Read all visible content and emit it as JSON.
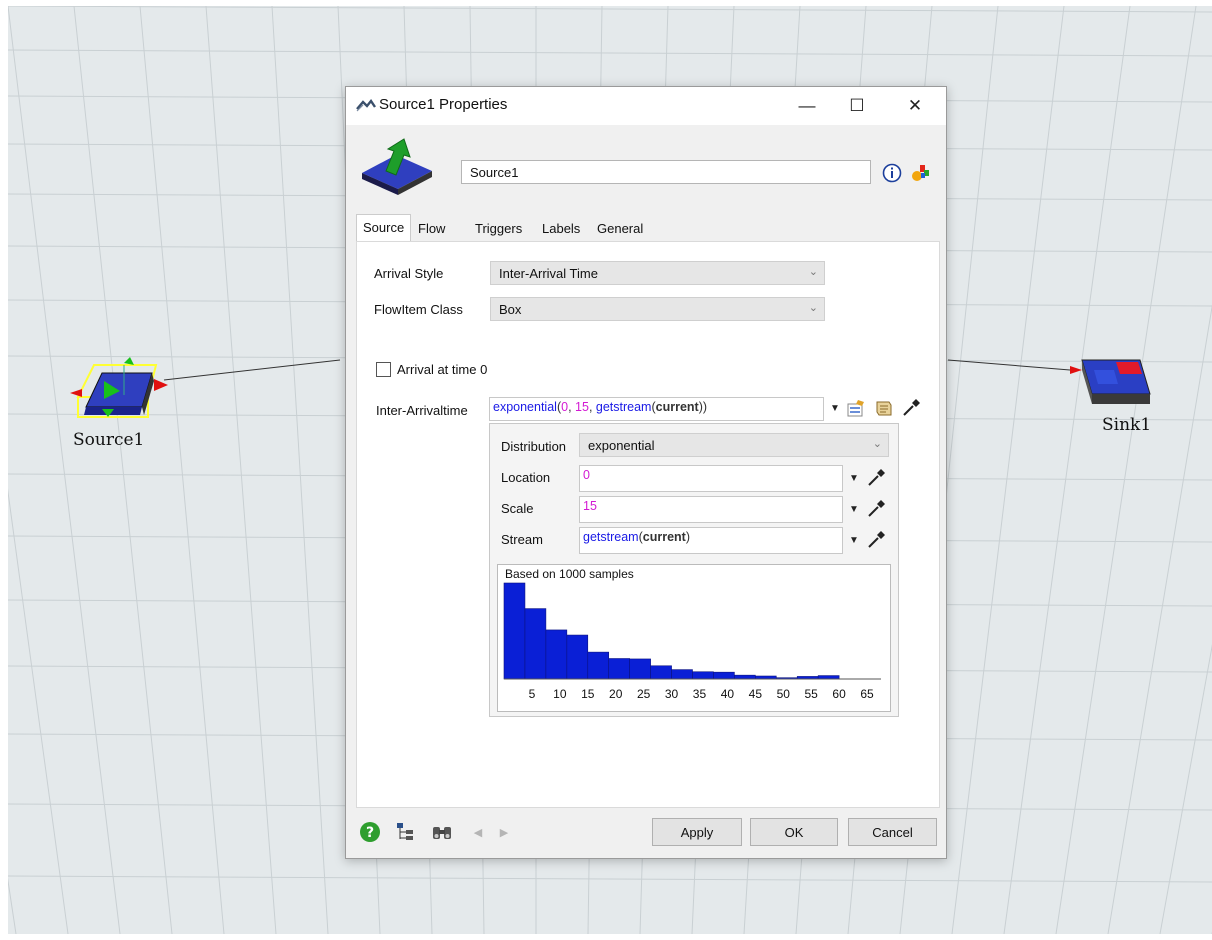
{
  "scene": {
    "source_label": "Source1",
    "sink_label": "Sink1"
  },
  "window": {
    "title": "Source1  Properties",
    "minimize": "—",
    "maximize": "☐",
    "close": "✕"
  },
  "header": {
    "object_name": "Source1",
    "info_icon": "info-icon",
    "color_icon": "color-picker-icon"
  },
  "tabs": [
    {
      "label": "Source",
      "active": true
    },
    {
      "label": "Flow",
      "active": false
    },
    {
      "label": "Triggers",
      "active": false
    },
    {
      "label": "Labels",
      "active": false
    },
    {
      "label": "General",
      "active": false
    }
  ],
  "source_tab": {
    "arrival_style_label": "Arrival Style",
    "arrival_style_value": "Inter-Arrival Time",
    "flowitem_class_label": "FlowItem Class",
    "flowitem_class_value": "Box",
    "arrival_time0_label": "Arrival at time 0",
    "arrival_time0_checked": false,
    "interarrival_label": "Inter-Arrivaltime",
    "interarrival_expr": {
      "fn1": "exponential",
      "p1": "(",
      "a1": "0",
      "c1": ", ",
      "a2": "15",
      "c2": ", ",
      "fn2": "getstream",
      "p2": "(",
      "a3": "current",
      "p3": "))"
    }
  },
  "distribution": {
    "distribution_label": "Distribution",
    "distribution_value": "exponential",
    "location_label": "Location",
    "location_value": "0",
    "scale_label": "Scale",
    "scale_value": "15",
    "stream_label": "Stream",
    "stream_fn": "getstream",
    "stream_open": "(",
    "stream_arg": "current",
    "stream_close": ")"
  },
  "chart_data": {
    "type": "bar",
    "title": "Based on 1000 samples",
    "xlabel": "",
    "ylabel": "",
    "bin_width": 3.75,
    "x_ticks": [
      5,
      10,
      15,
      20,
      25,
      30,
      35,
      40,
      45,
      50,
      55,
      60,
      65
    ],
    "xlim": [
      0,
      67.5
    ],
    "values": [
      225,
      165,
      115,
      103,
      63,
      48,
      47,
      31,
      22,
      17,
      16,
      9,
      7,
      3,
      6,
      8
    ],
    "ylim": [
      0,
      225
    ],
    "color": "#0a1fd6"
  },
  "footer": {
    "help_icon": "help-icon",
    "tree_icon": "tree-view-icon",
    "find_icon": "binoculars-icon",
    "prev_icon": "arrow-left-icon",
    "next_icon": "arrow-right-icon",
    "apply": "Apply",
    "ok": "OK",
    "cancel": "Cancel"
  }
}
